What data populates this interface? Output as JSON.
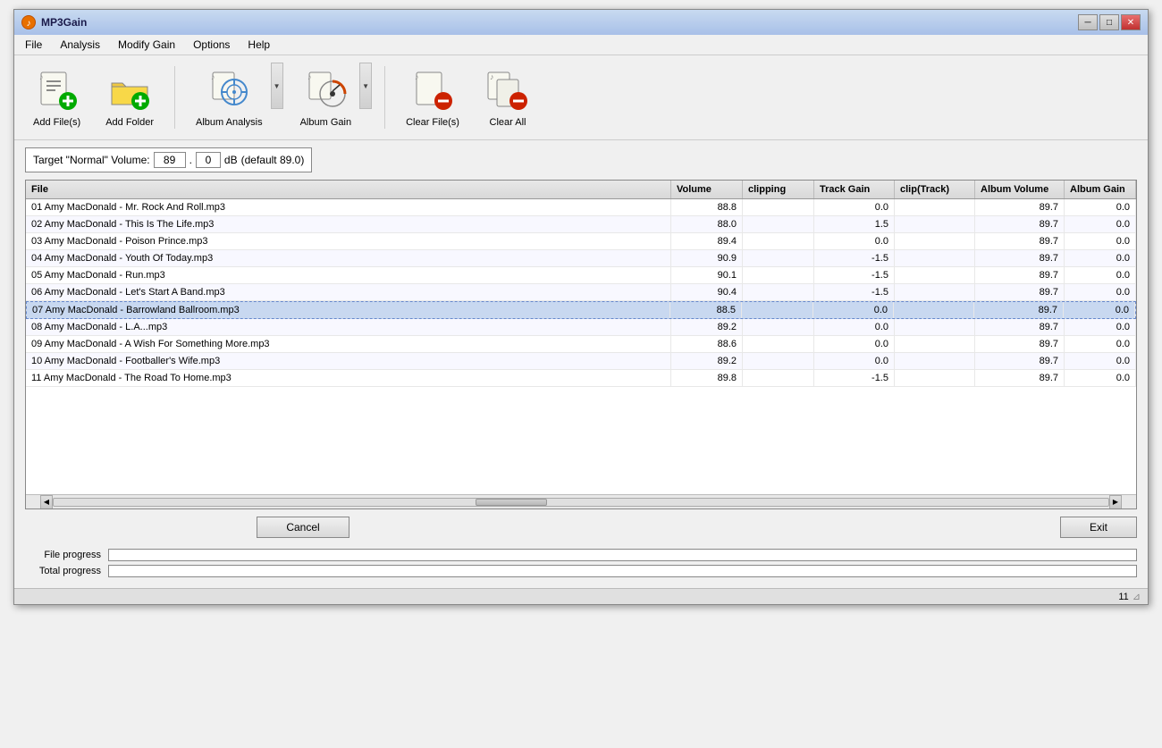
{
  "app": {
    "title": "MP3Gain",
    "icon": "♪"
  },
  "titleButtons": {
    "minimize": "─",
    "restore": "□",
    "close": "✕"
  },
  "menu": {
    "items": [
      "File",
      "Analysis",
      "Modify Gain",
      "Options",
      "Help"
    ]
  },
  "toolbar": {
    "buttons": [
      {
        "label": "Add File(s)",
        "name": "add-files-button"
      },
      {
        "label": "Add Folder",
        "name": "add-folder-button"
      },
      {
        "label": "Album Analysis",
        "name": "album-analysis-button"
      },
      {
        "label": "Album Gain",
        "name": "album-gain-button"
      },
      {
        "label": "Clear File(s)",
        "name": "clear-files-button"
      },
      {
        "label": "Clear All",
        "name": "clear-all-button"
      }
    ]
  },
  "target": {
    "label": "Target \"Normal\" Volume:",
    "value1": "89",
    "value2": "0",
    "unit": "dB",
    "default": "(default 89.0)"
  },
  "table": {
    "headers": [
      "File",
      "Volume",
      "clipping",
      "Track Gain",
      "clip(Track)",
      "Album Volume",
      "Album Gain"
    ],
    "rows": [
      {
        "file": "01  Amy MacDonald - Mr. Rock And Roll.mp3",
        "volume": "88.8",
        "clipping": "",
        "trackGain": "0.0",
        "clipTrack": "",
        "albumVolume": "89.7",
        "albumGain": "0.0",
        "selected": false
      },
      {
        "file": "02  Amy MacDonald - This Is The Life.mp3",
        "volume": "88.0",
        "clipping": "",
        "trackGain": "1.5",
        "clipTrack": "",
        "albumVolume": "89.7",
        "albumGain": "0.0",
        "selected": false
      },
      {
        "file": "03  Amy MacDonald - Poison Prince.mp3",
        "volume": "89.4",
        "clipping": "",
        "trackGain": "0.0",
        "clipTrack": "",
        "albumVolume": "89.7",
        "albumGain": "0.0",
        "selected": false
      },
      {
        "file": "04  Amy MacDonald - Youth Of Today.mp3",
        "volume": "90.9",
        "clipping": "",
        "trackGain": "-1.5",
        "clipTrack": "",
        "albumVolume": "89.7",
        "albumGain": "0.0",
        "selected": false
      },
      {
        "file": "05  Amy MacDonald - Run.mp3",
        "volume": "90.1",
        "clipping": "",
        "trackGain": "-1.5",
        "clipTrack": "",
        "albumVolume": "89.7",
        "albumGain": "0.0",
        "selected": false
      },
      {
        "file": "06  Amy MacDonald - Let's Start A Band.mp3",
        "volume": "90.4",
        "clipping": "",
        "trackGain": "-1.5",
        "clipTrack": "",
        "albumVolume": "89.7",
        "albumGain": "0.0",
        "selected": false
      },
      {
        "file": "07  Amy MacDonald - Barrowland Ballroom.mp3",
        "volume": "88.5",
        "clipping": "",
        "trackGain": "0.0",
        "clipTrack": "",
        "albumVolume": "89.7",
        "albumGain": "0.0",
        "selected": true
      },
      {
        "file": "08  Amy MacDonald - L.A...mp3",
        "volume": "89.2",
        "clipping": "",
        "trackGain": "0.0",
        "clipTrack": "",
        "albumVolume": "89.7",
        "albumGain": "0.0",
        "selected": false
      },
      {
        "file": "09  Amy MacDonald - A Wish For Something More.mp3",
        "volume": "88.6",
        "clipping": "",
        "trackGain": "0.0",
        "clipTrack": "",
        "albumVolume": "89.7",
        "albumGain": "0.0",
        "selected": false
      },
      {
        "file": "10  Amy MacDonald - Footballer's Wife.mp3",
        "volume": "89.2",
        "clipping": "",
        "trackGain": "0.0",
        "clipTrack": "",
        "albumVolume": "89.7",
        "albumGain": "0.0",
        "selected": false
      },
      {
        "file": "11  Amy MacDonald - The Road To Home.mp3",
        "volume": "89.8",
        "clipping": "",
        "trackGain": "-1.5",
        "clipTrack": "",
        "albumVolume": "89.7",
        "albumGain": "0.0",
        "selected": false
      }
    ]
  },
  "buttons": {
    "cancel": "Cancel",
    "exit": "Exit"
  },
  "progress": {
    "fileLabel": "File progress",
    "totalLabel": "Total progress"
  },
  "statusBar": {
    "count": "11"
  }
}
